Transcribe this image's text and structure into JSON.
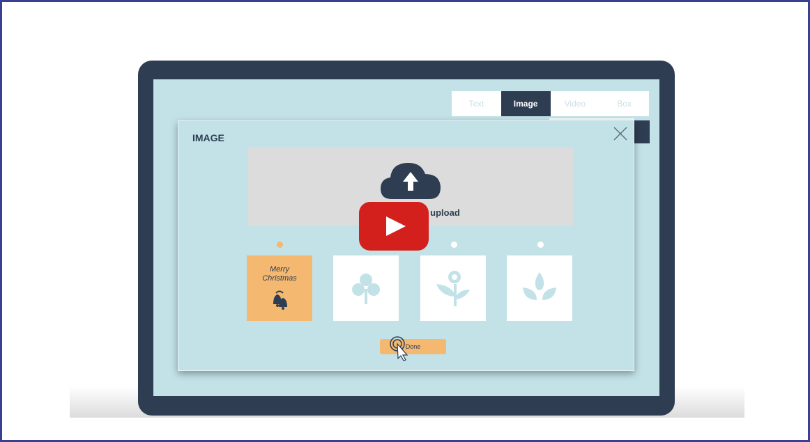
{
  "tabs": [
    {
      "label": "Text"
    },
    {
      "label": "Image"
    },
    {
      "label": "Video"
    },
    {
      "label": "Box"
    }
  ],
  "modal": {
    "title": "IMAGE",
    "upload_text": "Drop or click to upload",
    "close_icon": "close-icon",
    "upload_icon": "cloud-upload-icon",
    "done_label": "Done"
  },
  "thumbnails": [
    {
      "name": "christmas-bells",
      "caption_line1": "Merry",
      "caption_line2": "Christmas",
      "selected": true
    },
    {
      "name": "club-leaf",
      "selected": false
    },
    {
      "name": "flower",
      "selected": false
    },
    {
      "name": "sprout-leaves",
      "selected": false
    }
  ],
  "colors": {
    "frame_border": "#3a3f94",
    "laptop": "#2f3d52",
    "screen": "#c2e2e8",
    "selected": "#f4b870",
    "play_button": "#d3201c"
  }
}
